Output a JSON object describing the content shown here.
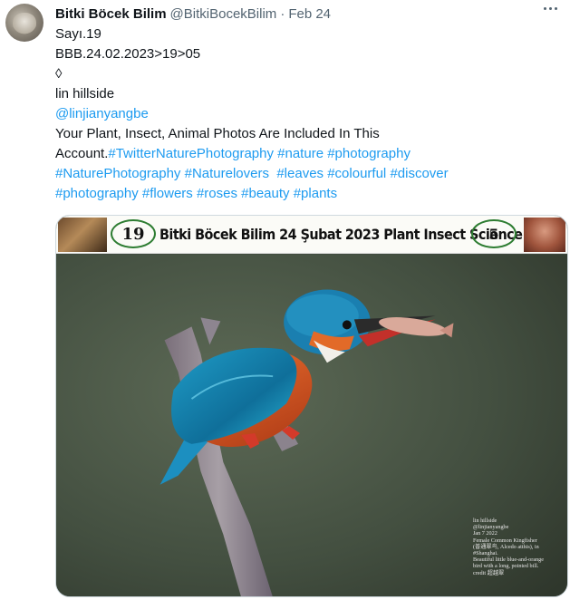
{
  "tweet": {
    "author_name": "Bitki Böcek Bilim",
    "handle": "@BitkiBocekBilim",
    "separator": "·",
    "date": "Feb 24",
    "lines": {
      "l1": "Sayı.19",
      "l2": "BBB.24.02.2023>19>05",
      "l3": "◊",
      "l4": "lin hillside",
      "l5_mention": "@linjianyangbe",
      "l6": "Your Plant, Insect, Animal Photos Are Included In This",
      "l7_text": "Account.",
      "l7_tags": [
        "#TwitterNaturePhotography",
        "#nature",
        "#photography"
      ],
      "l8_tags": [
        "#NaturePhotography",
        "#Naturelovers",
        " #leaves",
        "#colourful",
        "#discover"
      ],
      "l9_tags": [
        "#photography",
        "#flowers",
        "#roses",
        "#beauty",
        "#plants"
      ]
    }
  },
  "media": {
    "banner_issue": "19",
    "banner_title": "Bitki Böcek Bilim 24 Şubat 2023 Plant Insect Science",
    "banner_number": "5",
    "caption_lines": [
      "lin hillside",
      "@linjianyangbe",
      "Jan 7 2022",
      "Female Common Kingfisher",
      "(普通翠鸟, Alcedo atthis), in",
      "#Shanghai.",
      "Beautiful little blue-and-orange",
      "bird with a long, pointed bill.",
      "credit 超越翠"
    ]
  },
  "icons": {
    "more": "more-horizontal-icon"
  },
  "colors": {
    "link": "#1d9bf0",
    "muted": "#536471",
    "text": "#0f1419"
  }
}
